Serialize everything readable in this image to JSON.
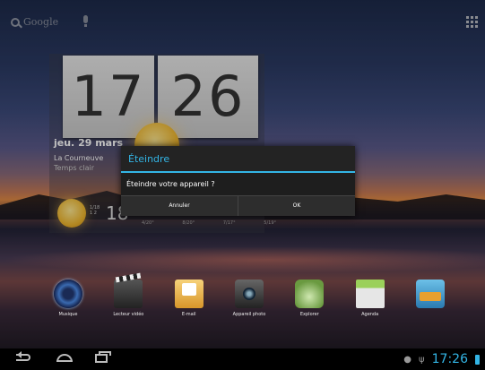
{
  "top_bar": {
    "search_label": "Google"
  },
  "clock_widget": {
    "hours": "17",
    "minutes": "26",
    "date": "jeu. 29 mars",
    "location": "La Courneuve",
    "condition": "Temps clair",
    "temperature": "18",
    "temp_small_1": "1/18",
    "temp_small_2": "1 2",
    "forecast": [
      "4/20°",
      "8/20°",
      "7/17°",
      "5/19°"
    ]
  },
  "dialog": {
    "title": "Éteindre",
    "message": "Éteindre votre appareil ?",
    "cancel_label": "Annuler",
    "ok_label": "OK"
  },
  "dock": {
    "apps": [
      {
        "label": "Musique",
        "icon": "music-icon"
      },
      {
        "label": "Lecteur vidéo",
        "icon": "video-player-icon"
      },
      {
        "label": "E-mail",
        "icon": "email-icon"
      },
      {
        "label": "Appareil photo",
        "icon": "camera-icon"
      },
      {
        "label": "Explorer",
        "icon": "explorer-icon"
      },
      {
        "label": "Agenda",
        "icon": "calendar-icon"
      },
      {
        "label": "",
        "icon": "market-icon"
      }
    ]
  },
  "status_bar": {
    "time": "17:26"
  },
  "colors": {
    "accent": "#33b5e5",
    "dialog_bg": "#232323"
  }
}
